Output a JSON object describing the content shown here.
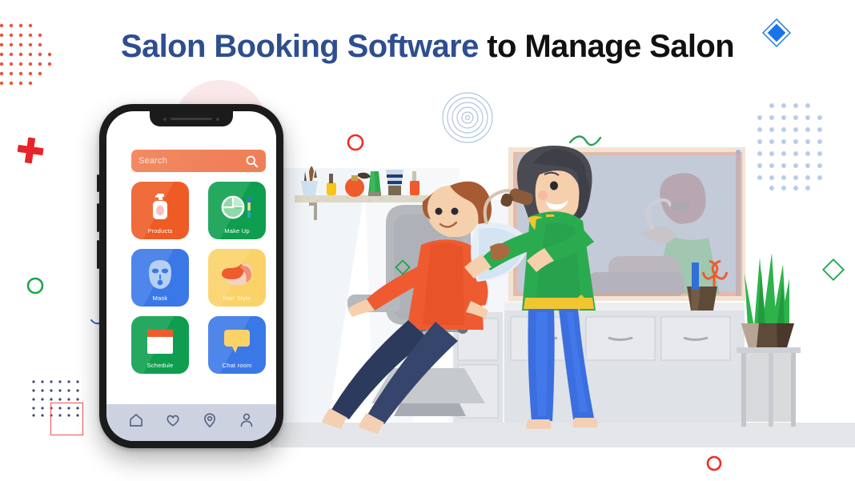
{
  "headline": {
    "accent_text": "Salon Booking Software",
    "plain_text": " to Manage Salon",
    "accent_color": "#2e4e8f",
    "highlight_color": "#b9c6df",
    "plain_color": "#111111"
  },
  "phone": {
    "search": {
      "placeholder": "Search",
      "icon": "search-icon",
      "background_color": "#f0815a"
    },
    "tiles": [
      {
        "label": "Products",
        "icon": "lotion-bottle-icon",
        "color": "#ef5b25"
      },
      {
        "label": "Make Up",
        "icon": "makeup-palette-icon",
        "color": "#0f9e4f"
      },
      {
        "label": "Mask",
        "icon": "face-mask-icon",
        "color": "#3b78e7"
      },
      {
        "label": "Hair Style",
        "icon": "hair-icon",
        "color": "#fbd268"
      },
      {
        "label": "Schedule",
        "icon": "calendar-icon",
        "color": "#0f9e4f"
      },
      {
        "label": "Chat room",
        "icon": "chat-bubble-icon",
        "color": "#3b78e7"
      }
    ],
    "bottom_nav": [
      {
        "icon": "home-icon",
        "name": "home"
      },
      {
        "icon": "heart-icon",
        "name": "favorites"
      },
      {
        "icon": "location-icon",
        "name": "location"
      },
      {
        "icon": "person-icon",
        "name": "profile"
      }
    ],
    "nav_icon_color": "#5a6383",
    "nav_background_color": "#ccd2e0"
  },
  "decorations": [
    {
      "name": "orange-dot-grid",
      "color": "#e8563a",
      "position": "top-left"
    },
    {
      "name": "red-plus-mark",
      "color": "#e8232a",
      "position": "left"
    },
    {
      "name": "green-circle-outline",
      "color": "#1aa64b",
      "position": "left"
    },
    {
      "name": "blue-dot-grid",
      "color": "#3f4a77",
      "position": "bottom-left"
    },
    {
      "name": "red-square-outline",
      "color": "#ef5350",
      "position": "bottom-left"
    },
    {
      "name": "blue-diamond",
      "color": "#1a73e8",
      "position": "top-right"
    },
    {
      "name": "light-blue-dot-grid",
      "color": "#b9cdea",
      "position": "right"
    },
    {
      "name": "red-circle-outline",
      "color": "#ef2b2b",
      "position": "center-top"
    },
    {
      "name": "concentric-rings",
      "color": "#aec4e3",
      "position": "center-top"
    },
    {
      "name": "green-diamond-outline",
      "color": "#1aa64b",
      "position": "center"
    },
    {
      "name": "green-diamond-outline-right",
      "color": "#1aa64b",
      "position": "right"
    },
    {
      "name": "red-circle-outline-bottom",
      "color": "#ef2b2b",
      "position": "bottom"
    },
    {
      "name": "green-squiggle",
      "color": "#2e9e5b",
      "position": "top-center"
    },
    {
      "name": "blue-arc",
      "color": "#2f5fd0",
      "position": "left-phone"
    }
  ],
  "scene": {
    "name": "salon-illustration",
    "description": "Hair stylist blow-drying a reclined client in a salon",
    "floor_color": "#e4e6e9",
    "stylist": {
      "top_color": "#2bab4f",
      "pants_color": "#3b6fe0",
      "hair_color": "#4a4a52"
    },
    "client": {
      "top_color": "#ef5b30",
      "pants_color": "#2c3a5e",
      "hair_color": "#a85a33"
    },
    "mirror_color": "#c3cad8",
    "cabinet_color": "#dfe2e6",
    "plant_color": "#2db34a",
    "shelf_color": "#ded8c8"
  }
}
